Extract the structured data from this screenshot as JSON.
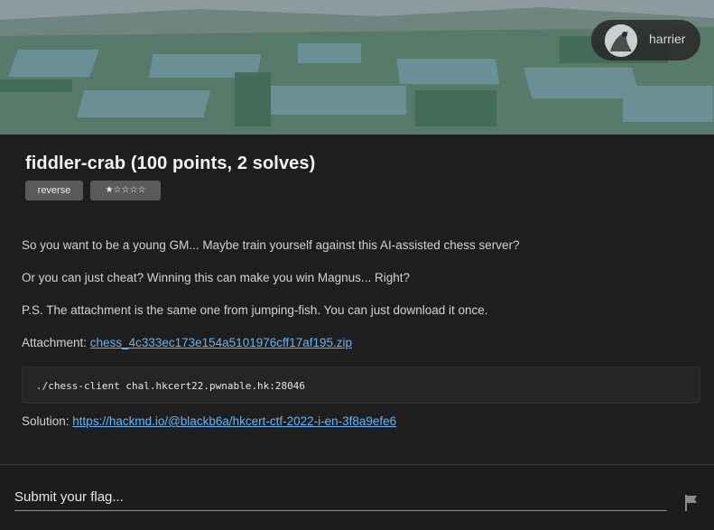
{
  "header": {
    "user": {
      "name": "harrier"
    }
  },
  "challenge": {
    "title": "fiddler-crab (100 points, 2 solves)",
    "tags": {
      "category": "reverse",
      "difficulty": "★☆☆☆☆"
    },
    "description": {
      "line1": "So you want to be a young GM... Maybe train yourself against this AI-assisted chess server?",
      "line2": "Or you can just cheat? Winning this can make you win Magnus... Right?",
      "line3": "P.S. The attachment is the same one from jumping-fish. You can just download it once."
    },
    "attachment": {
      "label": "Attachment: ",
      "filename": "chess_4c333ec173e154a5101976cff17af195.zip"
    },
    "command": "./chess-client chal.hkcert22.pwnable.hk:28046",
    "solution": {
      "label": "Solution: ",
      "url": "https://hackmd.io/@blackb6a/hkcert-ctf-2022-i-en-3f8a9efe6"
    }
  },
  "submit": {
    "placeholder": "Submit your flag..."
  },
  "colors": {
    "background": "#1e1e1e",
    "link": "#64b5f6",
    "tag": "#5a5a5a"
  },
  "icons": {
    "submit": "flag-icon"
  }
}
